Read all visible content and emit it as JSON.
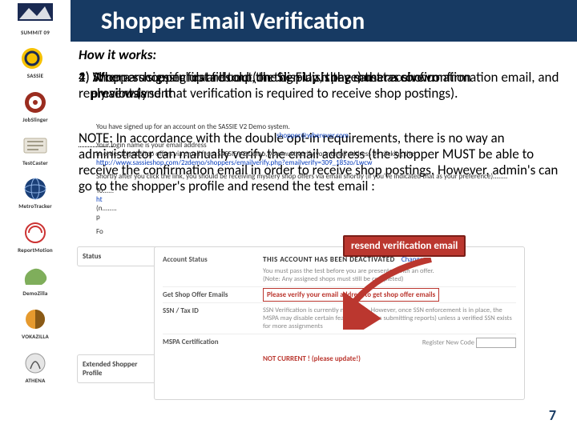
{
  "title": "Shopper Email Verification",
  "how_it_works_label": "How it works:",
  "overlap": {
    "layer1": "4) After a successful data dump, the display is the same as shown\n    previously",
    "layer2": "2) Shoppers signing up are told (on the Finish page) that a confirmation\n    email was sent",
    "layer3": "1) When a shopper first fills out the Sign Up, they must receive confirmation email, and reply sent (and that verification is required to receive shop postings)."
  },
  "note_html": "<span class='dotted'>NOTE:</span> In accordance with the double opt-in requirements, there is no way an administrator can manually verify the email address (the shopper MUST be able to receive the confirmation email in order to receive shop postings. However, admin's can go to the shopper's profile and resend the test email :",
  "mini_email": {
    "line1": "You have signed up for an account on the SASSIE V2 Demo system.",
    "addr": "shopper@wherever.com",
    "line2": "Your login name is your email address",
    "line3": "In order to get shop offers via email from SASSIE V2 Demo, you must verify your email address by clicking the",
    "link": "http://www.sassieshop.com/2zdemo/shoppers/emailverify.php?emailverify=309_185zo/Lwcw",
    "line4": "Shortly after you click the link, you should be receiving mystery shop offers via email shortly (if you've indicated that as your preference)........",
    "line5": "To......",
    "ht": "ht",
    "line6": "(n........",
    "p": "p",
    "fo": "Fo"
  },
  "panel": {
    "tabs": [
      "Status",
      "Extended Shopper Profile"
    ],
    "account_status_label": "Account Status",
    "deactivated": "THIS ACCOUNT HAS BEEN DEACTIVATED",
    "change": "Change",
    "pass_test_1": "You must pass the test before you are presented with an offer.",
    "pass_test_2": "(Note: Any assigned shops must still be completed)",
    "get_emails_label": "Get Shop Offer Emails",
    "verify_text": "Please verify your email address to get shop offer emails",
    "ssn_label": "SSN / Tax ID",
    "ssn_body_1": "SSN Verification is currently not active. However, once SSN enforcement is in place, the MSPA may disable certain features (such as submitting reports) unless a verified SSN exists",
    "ssn_body_2": "for more assignments",
    "mspa_label": "MSPA Certification",
    "reg_lab": "Register New Code",
    "not_current": "NOT CURRENT ! (please update!)"
  },
  "resend_label": "resend verification email",
  "page_number": "7",
  "logos": {
    "summit": "SUMMIT 09",
    "sassie": "SASSiE",
    "jobslinger": "JobSlinger",
    "testcaster": "TestCaster",
    "metrotracker": "MetroTracker",
    "reportmotion": "ReportMotion",
    "demozilla": "DemoZilla",
    "vokazilla": "VOKAZILLA",
    "athena": "ATHENA"
  }
}
